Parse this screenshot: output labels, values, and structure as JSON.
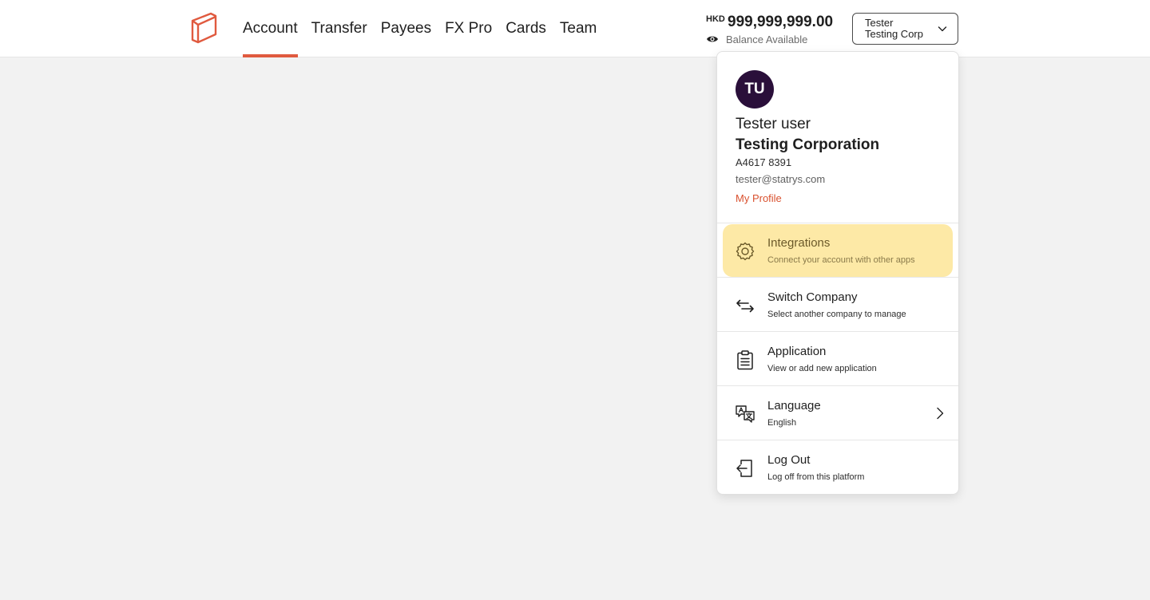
{
  "nav": {
    "items": [
      {
        "label": "Account",
        "active": true
      },
      {
        "label": "Transfer",
        "active": false
      },
      {
        "label": "Payees",
        "active": false
      },
      {
        "label": "FX Pro",
        "active": false
      },
      {
        "label": "Cards",
        "active": false
      },
      {
        "label": "Team",
        "active": false
      }
    ]
  },
  "balance": {
    "currency": "HKD",
    "amount": "999,999,999.00",
    "label": "Balance Available",
    "icon": "eye-icon"
  },
  "company_select": {
    "user": "Tester",
    "company": "Testing Corp",
    "icon": "chevron-down-icon"
  },
  "profile": {
    "initials": "TU",
    "name": "Tester user",
    "company": "Testing Corporation",
    "account_id": "A4617 8391",
    "email": "tester@statrys.com",
    "link": "My Profile"
  },
  "menu": {
    "items": [
      {
        "title": "Integrations",
        "subtitle": "Connect your account with other apps",
        "icon": "gear-icon",
        "highlighted": true
      },
      {
        "title": "Switch Company",
        "subtitle": "Select another company to manage",
        "icon": "switch-arrows-icon"
      },
      {
        "title": "Application",
        "subtitle": "View or add new application",
        "icon": "clipboard-icon"
      },
      {
        "title": "Language",
        "subtitle": "English",
        "icon": "translate-icon",
        "has_submenu": true
      },
      {
        "title": "Log Out",
        "subtitle": "Log off from this platform",
        "icon": "logout-icon"
      }
    ]
  },
  "colors": {
    "accent": "#e05a3f",
    "link": "#d9512f",
    "avatar_bg": "#2a0f3a",
    "highlight_bg": "#fde9a6",
    "page_bg": "#f2f2f2"
  }
}
